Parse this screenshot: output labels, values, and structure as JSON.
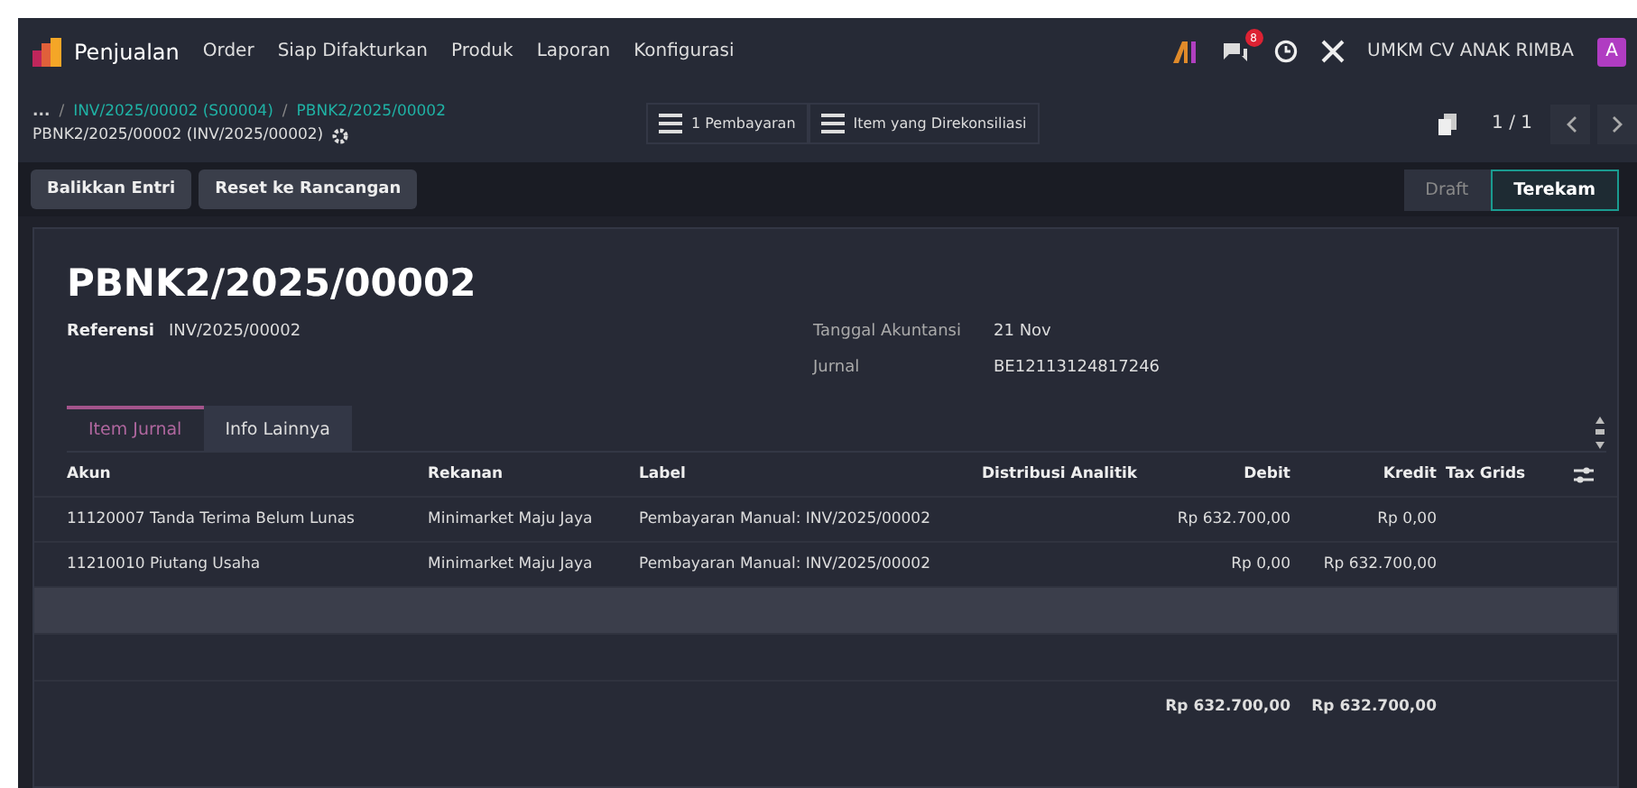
{
  "navbar": {
    "app_name": "Penjualan",
    "menu": [
      "Order",
      "Siap Difakturkan",
      "Produk",
      "Laporan",
      "Konfigurasi"
    ],
    "message_badge": "8",
    "company": "UMKM CV ANAK RIMBA",
    "avatar": "A"
  },
  "breadcrumbs": {
    "ellipsis": "...",
    "separator": "/",
    "links": [
      "INV/2025/00002 (S00004)",
      "PBNK2/2025/00002"
    ],
    "current": "PBNK2/2025/00002 (INV/2025/00002)"
  },
  "smart_buttons": [
    "1 Pembayaran",
    "Item yang Direkonsiliasi"
  ],
  "pager": "1 / 1",
  "actions": [
    "Balikkan Entri",
    "Reset ke Rancangan"
  ],
  "statusbar": [
    {
      "label": "Draft",
      "selected": false
    },
    {
      "label": "Terekam",
      "selected": true
    }
  ],
  "title": "PBNK2/2025/00002",
  "fields_left": [
    {
      "label": "Referensi",
      "value": "INV/2025/00002"
    }
  ],
  "fields_right": [
    {
      "label": "Tanggal Akuntansi",
      "value": "21 Nov"
    },
    {
      "label": "Jurnal",
      "value": "BE12113124817246"
    }
  ],
  "tabs": [
    {
      "label": "Item Jurnal",
      "selected": true
    },
    {
      "label": "Info Lainnya",
      "selected": false
    }
  ],
  "table": {
    "columns": [
      "Akun",
      "Rekanan",
      "Label",
      "Distribusi Analitik",
      "Debit",
      "Kredit",
      "Tax Grids"
    ],
    "rows": [
      [
        "11120007 Tanda Terima Belum Lunas",
        "Minimarket Maju Jaya",
        "Pembayaran Manual: INV/2025/00002",
        "",
        "Rp 632.700,00",
        "Rp 0,00",
        ""
      ],
      [
        "11210010 Piutang Usaha",
        "Minimarket Maju Jaya",
        "Pembayaran Manual: INV/2025/00002",
        "",
        "Rp 0,00",
        "Rp 632.700,00",
        ""
      ]
    ],
    "totals": {
      "debit": "Rp 632.700,00",
      "credit": "Rp 632.700,00"
    }
  }
}
